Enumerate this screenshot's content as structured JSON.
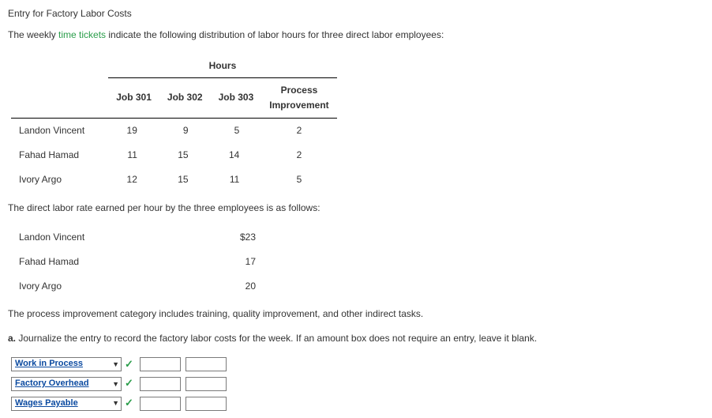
{
  "title": "Entry for Factory Labor Costs",
  "intro_pre": "The weekly ",
  "intro_link": "time tickets",
  "intro_post": " indicate the following distribution of labor hours for three direct labor employees:",
  "hours_header": "Hours",
  "cols": {
    "job301": "Job 301",
    "job302": "Job 302",
    "job303": "Job 303",
    "process_line1": "Process",
    "process_line2": "Improvement"
  },
  "rows": [
    {
      "name": "Landon Vincent",
      "j301": "19",
      "j302": "9",
      "j303": "5",
      "proc": "2"
    },
    {
      "name": "Fahad Hamad",
      "j301": "11",
      "j302": "15",
      "j303": "14",
      "proc": "2"
    },
    {
      "name": "Ivory Argo",
      "j301": "12",
      "j302": "15",
      "j303": "11",
      "proc": "5"
    }
  ],
  "rate_intro": "The direct labor rate earned per hour by the three employees is as follows:",
  "rates": [
    {
      "name": "Landon Vincent",
      "rate": "$23"
    },
    {
      "name": "Fahad Hamad",
      "rate": "17"
    },
    {
      "name": "Ivory Argo",
      "rate": "20"
    }
  ],
  "process_note": "The process improvement category includes training, quality improvement, and other indirect tasks.",
  "qa_label": "a.",
  "qa_text": " Journalize the entry to record the factory labor costs for the week. If an amount box does not require an entry, leave it blank.",
  "journal": [
    {
      "account": "Work in Process"
    },
    {
      "account": "Factory Overhead"
    },
    {
      "account": "Wages Payable"
    }
  ],
  "chart_data": {
    "type": "table",
    "title": "Distribution of labor hours",
    "columns": [
      "Job 301",
      "Job 302",
      "Job 303",
      "Process Improvement"
    ],
    "rows": [
      {
        "name": "Landon Vincent",
        "values": [
          19,
          9,
          5,
          2
        ]
      },
      {
        "name": "Fahad Hamad",
        "values": [
          11,
          15,
          14,
          2
        ]
      },
      {
        "name": "Ivory Argo",
        "values": [
          12,
          15,
          11,
          5
        ]
      }
    ],
    "rates": [
      {
        "name": "Landon Vincent",
        "rate": 23
      },
      {
        "name": "Fahad Hamad",
        "rate": 17
      },
      {
        "name": "Ivory Argo",
        "rate": 20
      }
    ]
  }
}
